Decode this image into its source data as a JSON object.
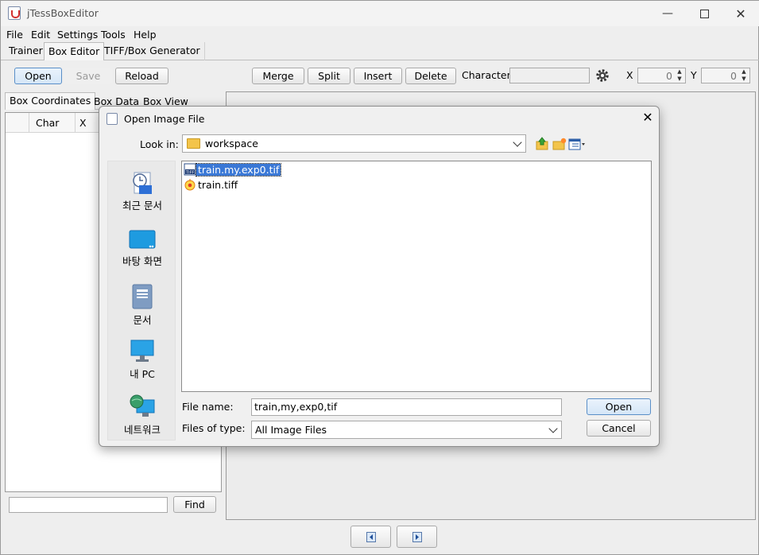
{
  "window": {
    "title": "jTessBoxEditor"
  },
  "menu": [
    "File",
    "Edit",
    "Settings",
    "Tools",
    "Help"
  ],
  "tabs": [
    "Trainer",
    "Box Editor",
    "TIFF/Box Generator"
  ],
  "toolbar": {
    "open": "Open",
    "save": "Save",
    "reload": "Reload",
    "merge": "Merge",
    "split": "Split",
    "insert": "Insert",
    "delete": "Delete",
    "character_label": "Character",
    "character_value": "",
    "x_label": "X",
    "x_value": "0",
    "y_label": "Y",
    "y_value": "0"
  },
  "left_tabs": [
    "Box Coordinates",
    "Box Data",
    "Box View"
  ],
  "table_headers": [
    "Char",
    "X"
  ],
  "find": {
    "value": "",
    "button": "Find"
  },
  "dialog": {
    "title": "Open Image File",
    "look_in_label": "Look in:",
    "look_in_value": "workspace",
    "places": [
      {
        "label": "최근 문서",
        "icon": "recent-items-icon"
      },
      {
        "label": "바탕 화면",
        "icon": "desktop-icon"
      },
      {
        "label": "문서",
        "icon": "documents-icon"
      },
      {
        "label": "내 PC",
        "icon": "this-pc-icon"
      },
      {
        "label": "네트워크",
        "icon": "network-icon"
      }
    ],
    "files": [
      {
        "name": "train.my.exp0.tif",
        "selected": true
      },
      {
        "name": "train.tiff",
        "selected": false
      }
    ],
    "file_name_label": "File name:",
    "file_name_value": "train,my,exp0,tif",
    "file_type_label": "Files of type:",
    "file_type_value": "All Image Files",
    "open_button": "Open",
    "cancel_button": "Cancel"
  },
  "colors": {
    "accent": "#3a78d6",
    "focus_border": "#5a8fc8"
  }
}
